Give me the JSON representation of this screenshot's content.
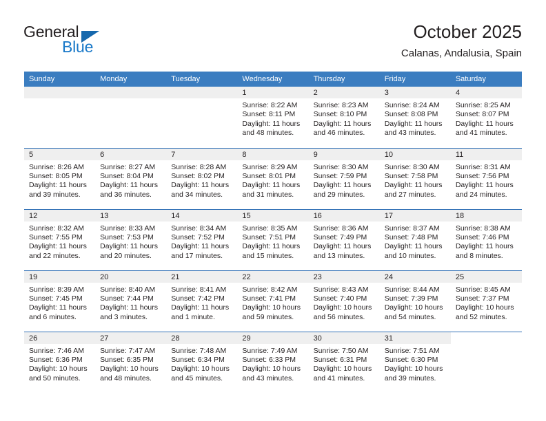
{
  "brand": {
    "name_top": "General",
    "name_bottom": "Blue",
    "triangle_color": "#1668ad",
    "blue_color": "#1878c8"
  },
  "header": {
    "title": "October 2025",
    "subtitle": "Calanas, Andalusia, Spain",
    "header_bg": "#3b7dc0",
    "row_divider": "#2f6fb5",
    "daynum_bg": "#efefef"
  },
  "calendar": {
    "weekday_headers": [
      "Sunday",
      "Monday",
      "Tuesday",
      "Wednesday",
      "Thursday",
      "Friday",
      "Saturday"
    ],
    "weeks": [
      [
        {
          "day": "",
          "empty": true
        },
        {
          "day": "",
          "empty": true
        },
        {
          "day": "",
          "empty": true
        },
        {
          "day": "1",
          "sunrise": "Sunrise: 8:22 AM",
          "sunset": "Sunset: 8:11 PM",
          "daylight": "Daylight: 11 hours and 48 minutes."
        },
        {
          "day": "2",
          "sunrise": "Sunrise: 8:23 AM",
          "sunset": "Sunset: 8:10 PM",
          "daylight": "Daylight: 11 hours and 46 minutes."
        },
        {
          "day": "3",
          "sunrise": "Sunrise: 8:24 AM",
          "sunset": "Sunset: 8:08 PM",
          "daylight": "Daylight: 11 hours and 43 minutes."
        },
        {
          "day": "4",
          "sunrise": "Sunrise: 8:25 AM",
          "sunset": "Sunset: 8:07 PM",
          "daylight": "Daylight: 11 hours and 41 minutes."
        }
      ],
      [
        {
          "day": "5",
          "sunrise": "Sunrise: 8:26 AM",
          "sunset": "Sunset: 8:05 PM",
          "daylight": "Daylight: 11 hours and 39 minutes."
        },
        {
          "day": "6",
          "sunrise": "Sunrise: 8:27 AM",
          "sunset": "Sunset: 8:04 PM",
          "daylight": "Daylight: 11 hours and 36 minutes."
        },
        {
          "day": "7",
          "sunrise": "Sunrise: 8:28 AM",
          "sunset": "Sunset: 8:02 PM",
          "daylight": "Daylight: 11 hours and 34 minutes."
        },
        {
          "day": "8",
          "sunrise": "Sunrise: 8:29 AM",
          "sunset": "Sunset: 8:01 PM",
          "daylight": "Daylight: 11 hours and 31 minutes."
        },
        {
          "day": "9",
          "sunrise": "Sunrise: 8:30 AM",
          "sunset": "Sunset: 7:59 PM",
          "daylight": "Daylight: 11 hours and 29 minutes."
        },
        {
          "day": "10",
          "sunrise": "Sunrise: 8:30 AM",
          "sunset": "Sunset: 7:58 PM",
          "daylight": "Daylight: 11 hours and 27 minutes."
        },
        {
          "day": "11",
          "sunrise": "Sunrise: 8:31 AM",
          "sunset": "Sunset: 7:56 PM",
          "daylight": "Daylight: 11 hours and 24 minutes."
        }
      ],
      [
        {
          "day": "12",
          "sunrise": "Sunrise: 8:32 AM",
          "sunset": "Sunset: 7:55 PM",
          "daylight": "Daylight: 11 hours and 22 minutes."
        },
        {
          "day": "13",
          "sunrise": "Sunrise: 8:33 AM",
          "sunset": "Sunset: 7:53 PM",
          "daylight": "Daylight: 11 hours and 20 minutes."
        },
        {
          "day": "14",
          "sunrise": "Sunrise: 8:34 AM",
          "sunset": "Sunset: 7:52 PM",
          "daylight": "Daylight: 11 hours and 17 minutes."
        },
        {
          "day": "15",
          "sunrise": "Sunrise: 8:35 AM",
          "sunset": "Sunset: 7:51 PM",
          "daylight": "Daylight: 11 hours and 15 minutes."
        },
        {
          "day": "16",
          "sunrise": "Sunrise: 8:36 AM",
          "sunset": "Sunset: 7:49 PM",
          "daylight": "Daylight: 11 hours and 13 minutes."
        },
        {
          "day": "17",
          "sunrise": "Sunrise: 8:37 AM",
          "sunset": "Sunset: 7:48 PM",
          "daylight": "Daylight: 11 hours and 10 minutes."
        },
        {
          "day": "18",
          "sunrise": "Sunrise: 8:38 AM",
          "sunset": "Sunset: 7:46 PM",
          "daylight": "Daylight: 11 hours and 8 minutes."
        }
      ],
      [
        {
          "day": "19",
          "sunrise": "Sunrise: 8:39 AM",
          "sunset": "Sunset: 7:45 PM",
          "daylight": "Daylight: 11 hours and 6 minutes."
        },
        {
          "day": "20",
          "sunrise": "Sunrise: 8:40 AM",
          "sunset": "Sunset: 7:44 PM",
          "daylight": "Daylight: 11 hours and 3 minutes."
        },
        {
          "day": "21",
          "sunrise": "Sunrise: 8:41 AM",
          "sunset": "Sunset: 7:42 PM",
          "daylight": "Daylight: 11 hours and 1 minute."
        },
        {
          "day": "22",
          "sunrise": "Sunrise: 8:42 AM",
          "sunset": "Sunset: 7:41 PM",
          "daylight": "Daylight: 10 hours and 59 minutes."
        },
        {
          "day": "23",
          "sunrise": "Sunrise: 8:43 AM",
          "sunset": "Sunset: 7:40 PM",
          "daylight": "Daylight: 10 hours and 56 minutes."
        },
        {
          "day": "24",
          "sunrise": "Sunrise: 8:44 AM",
          "sunset": "Sunset: 7:39 PM",
          "daylight": "Daylight: 10 hours and 54 minutes."
        },
        {
          "day": "25",
          "sunrise": "Sunrise: 8:45 AM",
          "sunset": "Sunset: 7:37 PM",
          "daylight": "Daylight: 10 hours and 52 minutes."
        }
      ],
      [
        {
          "day": "26",
          "sunrise": "Sunrise: 7:46 AM",
          "sunset": "Sunset: 6:36 PM",
          "daylight": "Daylight: 10 hours and 50 minutes."
        },
        {
          "day": "27",
          "sunrise": "Sunrise: 7:47 AM",
          "sunset": "Sunset: 6:35 PM",
          "daylight": "Daylight: 10 hours and 48 minutes."
        },
        {
          "day": "28",
          "sunrise": "Sunrise: 7:48 AM",
          "sunset": "Sunset: 6:34 PM",
          "daylight": "Daylight: 10 hours and 45 minutes."
        },
        {
          "day": "29",
          "sunrise": "Sunrise: 7:49 AM",
          "sunset": "Sunset: 6:33 PM",
          "daylight": "Daylight: 10 hours and 43 minutes."
        },
        {
          "day": "30",
          "sunrise": "Sunrise: 7:50 AM",
          "sunset": "Sunset: 6:31 PM",
          "daylight": "Daylight: 10 hours and 41 minutes."
        },
        {
          "day": "31",
          "sunrise": "Sunrise: 7:51 AM",
          "sunset": "Sunset: 6:30 PM",
          "daylight": "Daylight: 10 hours and 39 minutes."
        },
        {
          "day": "",
          "empty": true,
          "blank_tail": true
        }
      ]
    ]
  }
}
